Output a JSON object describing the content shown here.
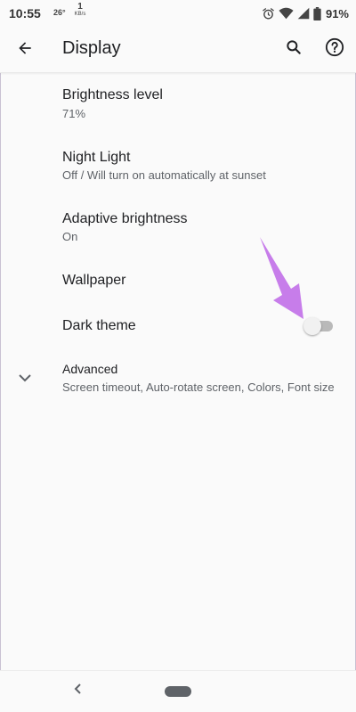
{
  "status_bar": {
    "time": "10:55",
    "temperature": "26°",
    "net_speed_value": "1",
    "net_speed_unit": "KB/s",
    "battery_percent": "91%",
    "icons": [
      "alarm-icon",
      "wifi-icon",
      "signal-icon",
      "battery-icon"
    ]
  },
  "app_bar": {
    "title": "Display",
    "icons": [
      "back-arrow-icon",
      "search-icon",
      "help-icon"
    ]
  },
  "settings": [
    {
      "title": "Brightness level",
      "summary": "71%"
    },
    {
      "title": "Night Light",
      "summary": "Off / Will turn on automatically at sunset"
    },
    {
      "title": "Adaptive brightness",
      "summary": "On"
    },
    {
      "title": "Wallpaper"
    },
    {
      "title": "Dark theme",
      "toggle_on": false
    }
  ],
  "advanced": {
    "title": "Advanced",
    "summary": "Screen timeout, Auto-rotate screen, Colors, Font size",
    "icon": "chevron-down-icon"
  },
  "nav_bar": {
    "icons": [
      "nav-back-icon",
      "home-pill-icon"
    ]
  },
  "colors": {
    "background": "#fafafa",
    "annotation_arrow": "#c77dea",
    "toggle_off_track": "#b9b9b9"
  }
}
